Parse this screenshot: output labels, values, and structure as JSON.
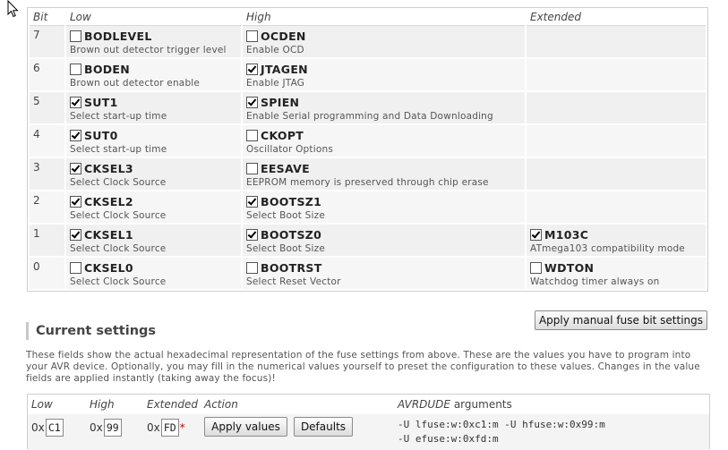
{
  "table": {
    "headers": {
      "bit": "Bit",
      "low": "Low",
      "high": "High",
      "extended": "Extended"
    },
    "rows": [
      {
        "bit": "7",
        "low": {
          "name": "BODLEVEL",
          "desc": "Brown out detector trigger level",
          "checked": false
        },
        "high": {
          "name": "OCDEN",
          "desc": "Enable OCD",
          "checked": false
        },
        "ext": null
      },
      {
        "bit": "6",
        "low": {
          "name": "BODEN",
          "desc": "Brown out detector enable",
          "checked": false
        },
        "high": {
          "name": "JTAGEN",
          "desc": "Enable JTAG",
          "checked": true
        },
        "ext": null
      },
      {
        "bit": "5",
        "low": {
          "name": "SUT1",
          "desc": "Select start-up time",
          "checked": true
        },
        "high": {
          "name": "SPIEN",
          "desc": "Enable Serial programming and Data Downloading",
          "checked": true
        },
        "ext": null
      },
      {
        "bit": "4",
        "low": {
          "name": "SUT0",
          "desc": "Select start-up time",
          "checked": true
        },
        "high": {
          "name": "CKOPT",
          "desc": "Oscillator Options",
          "checked": false
        },
        "ext": null
      },
      {
        "bit": "3",
        "low": {
          "name": "CKSEL3",
          "desc": "Select Clock Source",
          "checked": true
        },
        "high": {
          "name": "EESAVE",
          "desc": "EEPROM memory is preserved through chip erase",
          "checked": false
        },
        "ext": null
      },
      {
        "bit": "2",
        "low": {
          "name": "CKSEL2",
          "desc": "Select Clock Source",
          "checked": true
        },
        "high": {
          "name": "BOOTSZ1",
          "desc": "Select Boot Size",
          "checked": true
        },
        "ext": null
      },
      {
        "bit": "1",
        "low": {
          "name": "CKSEL1",
          "desc": "Select Clock Source",
          "checked": true
        },
        "high": {
          "name": "BOOTSZ0",
          "desc": "Select Boot Size",
          "checked": true
        },
        "ext": {
          "name": "M103C",
          "desc": "ATmega103 compatibility mode",
          "checked": true
        }
      },
      {
        "bit": "0",
        "low": {
          "name": "CKSEL0",
          "desc": "Select Clock Source",
          "checked": false
        },
        "high": {
          "name": "BOOTRST",
          "desc": "Select Reset Vector",
          "checked": false
        },
        "ext": {
          "name": "WDTON",
          "desc": "Watchdog timer always on",
          "checked": false
        }
      }
    ]
  },
  "manual_button": "Apply manual fuse bit settings",
  "current": {
    "title": "Current settings",
    "description": "These fields show the actual hexadecimal representation of the fuse settings from above. These are the values you have to program into your AVR device. Optionally, you may fill in the numerical values yourself to preset the configuration to these values. Changes in the value fields are applied instantly (taking away the focus)!",
    "headers": {
      "low": "Low",
      "high": "High",
      "extended": "Extended",
      "action": "Action",
      "args_prefix": "AVRDUDE",
      "args_suffix": " arguments"
    },
    "hex_prefix": "0x",
    "low": "C1",
    "high": "99",
    "extended": "FD",
    "required_mark": "*",
    "apply_button": "Apply values",
    "defaults_button": "Defaults",
    "args_line1": "-U lfuse:w:0xc1:m -U hfuse:w:0x99:m",
    "args_line2": "-U efuse:w:0xfd:m"
  }
}
